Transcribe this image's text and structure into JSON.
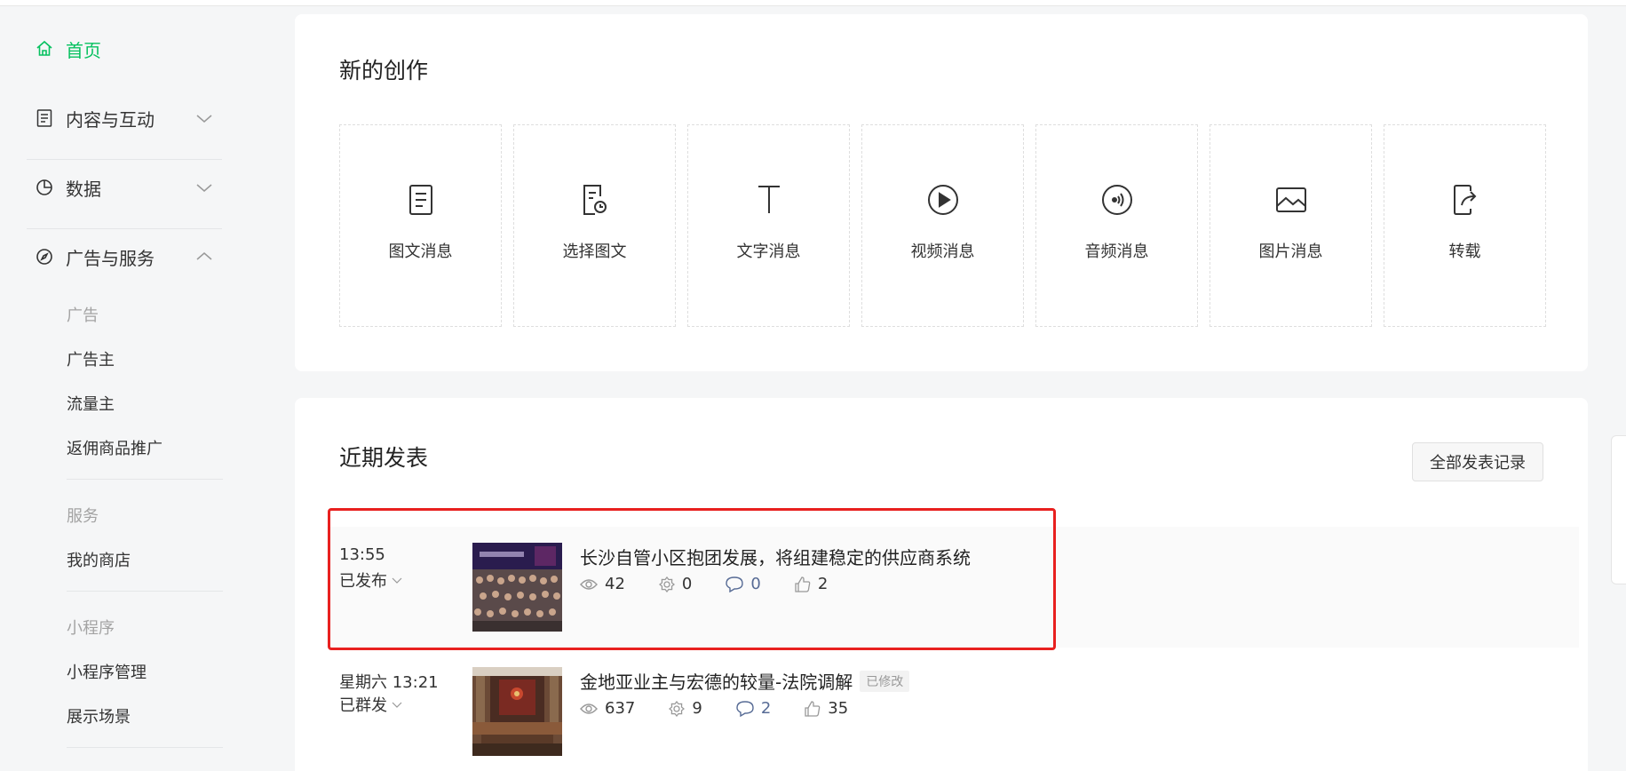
{
  "sidebar": {
    "home": "首页",
    "content": "内容与互动",
    "data": "数据",
    "ads": "广告与服务",
    "ads_section": {
      "group1_title": "广告",
      "advertiser": "广告主",
      "publisher": "流量主",
      "promotion": "返佣商品推广",
      "group2_title": "服务",
      "my_shop": "我的商店",
      "group3_title": "小程序",
      "mp_manage": "小程序管理",
      "showcase": "展示场景"
    }
  },
  "create": {
    "title": "新的创作",
    "tiles": [
      {
        "label": "图文消息",
        "icon": "article-icon"
      },
      {
        "label": "选择图文",
        "icon": "select-article-icon"
      },
      {
        "label": "文字消息",
        "icon": "text-icon"
      },
      {
        "label": "视频消息",
        "icon": "video-icon"
      },
      {
        "label": "音频消息",
        "icon": "audio-icon"
      },
      {
        "label": "图片消息",
        "icon": "image-icon"
      },
      {
        "label": "转载",
        "icon": "repost-icon"
      }
    ]
  },
  "recent": {
    "title": "近期发表",
    "all_button": "全部发表记录",
    "posts": [
      {
        "time": "13:55",
        "status": "已发布",
        "title": "长沙自管小区抱团发展，将组建稳定的供应商系统",
        "tag": "",
        "views": "42",
        "shares": "0",
        "comments": "0",
        "likes": "2"
      },
      {
        "time": "星期六 13:21",
        "status": "已群发",
        "title": "金地亚业主与宏德的较量-法院调解",
        "tag": "已修改",
        "views": "637",
        "shares": "9",
        "comments": "2",
        "likes": "35"
      }
    ]
  },
  "colors": {
    "accent": "#07c160",
    "highlight_box": "#e8201f",
    "comment_blue": "#576b95"
  }
}
